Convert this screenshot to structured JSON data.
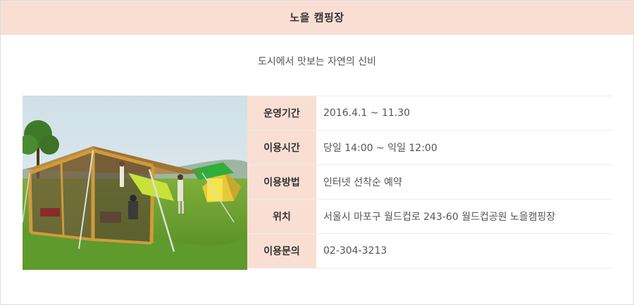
{
  "header": {
    "title": "노을 캠핑장"
  },
  "subtitle": "도시에서 맛보는 자연의 신비",
  "photo": {
    "icon": "camping-tent-photo"
  },
  "info": {
    "rows": [
      {
        "label": "운영기간",
        "value": "2016.4.1 ~ 11.30"
      },
      {
        "label": "이용시간",
        "value": "당일 14:00 ~ 익일 12:00"
      },
      {
        "label": "이용방법",
        "value": "인터넷 선착순 예약"
      },
      {
        "label": "위치",
        "value": "서울시 마포구 월드컵로 243-60 월드컵공원 노을캠핑장"
      },
      {
        "label": "이용문의",
        "value": "02-304-3213"
      }
    ]
  },
  "colors": {
    "header_bg": "#f9dfd3",
    "label_bg": "#f9dfd3",
    "border": "#ececec"
  }
}
